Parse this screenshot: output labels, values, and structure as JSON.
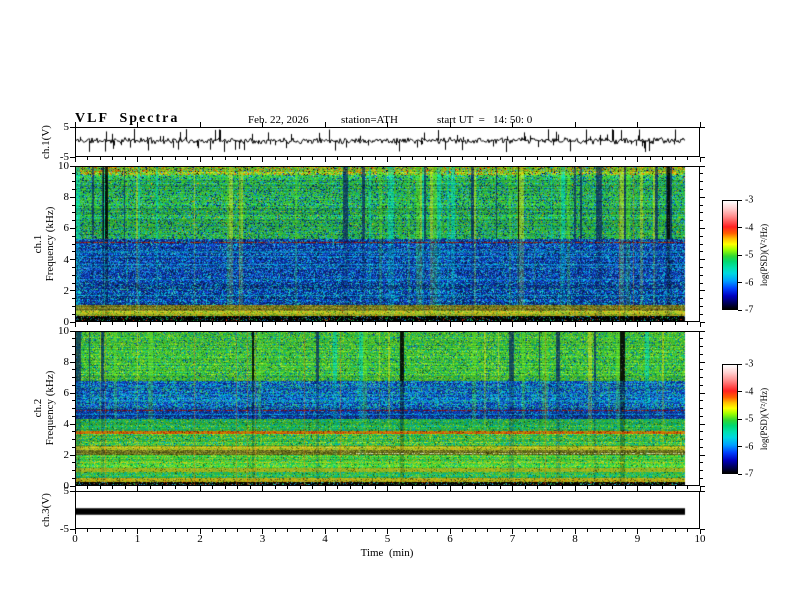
{
  "header": {
    "title": "VLF  Spectra",
    "date": "Feb. 22, 2026",
    "station": "station=ATH",
    "start_ut": "start UT  =   14: 50: 0"
  },
  "axes": {
    "x_label": "Time  (min)",
    "x_tick_labels": [
      "0",
      "1",
      "2",
      "3",
      "4",
      "5",
      "6",
      "7",
      "8",
      "9",
      "10"
    ],
    "freq_tick_labels": [
      "10",
      "8",
      "6",
      "4",
      "2",
      "0"
    ],
    "volt_top_label": "5",
    "volt_bottom_label": "-5"
  },
  "panels": {
    "ch1_wave": {
      "ylabel": "ch.1(V)"
    },
    "ch1_spec": {
      "ylabel_ch": "ch.1",
      "ylabel_freq": "Frequency  (kHz)"
    },
    "ch2_spec": {
      "ylabel_ch": "ch.2",
      "ylabel_freq": "Frequency  (kHz)"
    },
    "ch3_wave": {
      "ylabel": "ch.3(V)"
    }
  },
  "colorbar": {
    "label": "log(PSD)(V²/Hz)",
    "tick_labels": [
      "-3",
      "-4",
      "-5",
      "-6",
      "-7"
    ],
    "gradient": [
      [
        "#ffffff",
        0
      ],
      [
        "#ffd0d0",
        7
      ],
      [
        "#ff9090",
        14
      ],
      [
        "#ff2020",
        24
      ],
      [
        "#ff6000",
        30
      ],
      [
        "#ffc000",
        35
      ],
      [
        "#ffff00",
        40
      ],
      [
        "#a0ff00",
        45
      ],
      [
        "#30d830",
        51
      ],
      [
        "#00d870",
        56
      ],
      [
        "#00e0b0",
        62
      ],
      [
        "#00d8e0",
        67
      ],
      [
        "#00a0ff",
        74
      ],
      [
        "#0040ff",
        81
      ],
      [
        "#0000c0",
        88
      ],
      [
        "#000050",
        95
      ],
      [
        "#000000",
        100
      ]
    ]
  },
  "chart_data": [
    {
      "id": "ch1_voltage",
      "type": "line",
      "x_range_min": [
        0,
        10
      ],
      "x_data_end_min": 9.78,
      "y_range": [
        -5,
        5
      ],
      "y_unit": "V",
      "baseline": 0.5,
      "noise_amp": 1.3,
      "n_spikes": 85,
      "spike_amp": [
        1.2,
        4.2
      ],
      "spike_down_frac": 0.6,
      "seed": 11
    },
    {
      "id": "ch1_spectrogram",
      "type": "heatmap",
      "x_range_min": [
        0,
        10
      ],
      "x_data_end_min": 9.78,
      "y_range_khz": [
        0,
        10
      ],
      "z_label": "log(PSD)(V²/Hz)",
      "z_range": [
        -7,
        -3
      ],
      "seed": 101,
      "row_jitter": 0.3,
      "stripes": {
        "p_black": 0.05,
        "p_dark": 0.07,
        "p_bright": 0.24,
        "max_run": 4,
        "bright_colors": [
          "#58dc20",
          "#00dcb8",
          "#c8e018"
        ]
      },
      "bands": [
        {
          "f0": 9.5,
          "f1": 10,
          "stripe": 0.9,
          "palette": [
            [
              "#50c428",
              3
            ],
            [
              "#88d420",
              2.5
            ],
            [
              "#c8d820",
              1.5
            ],
            [
              "#e89800",
              1.2
            ],
            [
              "#e05000",
              0.7
            ],
            [
              "#28a8d8",
              0.8
            ],
            [
              "#0a2a80",
              0.5
            ],
            [
              "#000000",
              0.3
            ]
          ]
        },
        {
          "f0": 5.3,
          "f1": 9.5,
          "stripe": 1,
          "palette": [
            [
              "#30b438",
              3
            ],
            [
              "#48c828",
              3
            ],
            [
              "#18a058",
              2
            ],
            [
              "#00c090",
              1.2
            ],
            [
              "#28a8d0",
              1
            ],
            [
              "#0a50b8",
              0.8
            ],
            [
              "#082868",
              0.8
            ],
            [
              "#e08800",
              0.15
            ]
          ]
        },
        {
          "f0": 2.45,
          "f1": 5.3,
          "stripe": 0.45,
          "bright_row": 0.12,
          "palette": [
            [
              "#0a2a90",
              3
            ],
            [
              "#1048c8",
              3
            ],
            [
              "#2080d8",
              1.4
            ],
            [
              "#00b0d8",
              1.1
            ],
            [
              "#062050",
              1.3
            ],
            [
              "#30c090",
              0.35
            ]
          ]
        },
        {
          "f0": 1.05,
          "f1": 2.45,
          "stripe": 0.35,
          "bright_row": 0.14,
          "palette": [
            [
              "#0a2a90",
              3
            ],
            [
              "#1048c8",
              2
            ],
            [
              "#00a0c8",
              1.6
            ],
            [
              "#062050",
              1.6
            ],
            [
              "#28b8a0",
              0.6
            ]
          ]
        },
        {
          "f0": 0.62,
          "f1": 1.05,
          "stripe": 0.2,
          "palette": [
            [
              "#7e7e1e",
              3
            ],
            [
              "#9a9a28",
              2
            ],
            [
              "#5e6e1a",
              2
            ],
            [
              "#8a4e10",
              1
            ],
            [
              "#3e5e10",
              1
            ]
          ]
        },
        {
          "f0": 0.35,
          "f1": 0.62,
          "stripe": 0.2,
          "palette": [
            [
              "#bcbc1e",
              3
            ],
            [
              "#8cbc28",
              2
            ],
            [
              "#cc9c10",
              1.2
            ],
            [
              "#5a9c1c",
              1
            ]
          ]
        },
        {
          "f0": 0,
          "f1": 0.35,
          "stripe": 0,
          "palette": [
            [
              "#000000",
              5
            ],
            [
              "#0a3014",
              0.5
            ],
            [
              "#10a040",
              0.5
            ],
            [
              "#0868b0",
              0.4
            ],
            [
              "#b02408",
              0.2
            ]
          ]
        }
      ],
      "hlines": [
        {
          "f": 5.1,
          "colors": [
            "#780020",
            "#a83808"
          ],
          "density": 0.75
        },
        {
          "f": 2.1,
          "colors": [
            "#28b890",
            "#1048c8"
          ],
          "density": 0.6
        },
        {
          "f": 1.75,
          "colors": [
            "#2090c0",
            "#0a2a90"
          ],
          "density": 0.5
        }
      ]
    },
    {
      "id": "ch2_spectrogram",
      "type": "heatmap",
      "x_range_min": [
        0,
        10
      ],
      "x_data_end_min": 9.78,
      "y_range_khz": [
        0,
        10
      ],
      "z_label": "log(PSD)(V²/Hz)",
      "z_range": [
        -7,
        -3
      ],
      "seed": 202,
      "row_jitter": 0.25,
      "stripes": {
        "p_black": 0.085,
        "p_dark": 0.06,
        "p_bright": 0.22,
        "max_run": 5,
        "bright_colors": [
          "#60dc20",
          "#00dcb8",
          "#d4dc14"
        ]
      },
      "bands": [
        {
          "f0": 6.8,
          "f1": 10,
          "stripe": 1,
          "palette": [
            [
              "#38bc30",
              3
            ],
            [
              "#58cc28",
              3
            ],
            [
              "#18a858",
              2
            ],
            [
              "#9cd420",
              1.2
            ],
            [
              "#00bca0",
              0.7
            ],
            [
              "#0a50b8",
              0.5
            ]
          ]
        },
        {
          "f0": 5.0,
          "f1": 6.8,
          "stripe": 0.55,
          "bright_row": 0.12,
          "palette": [
            [
              "#1048c8",
              2.2
            ],
            [
              "#0a2a90",
              2.2
            ],
            [
              "#00b0d8",
              1.8
            ],
            [
              "#2080d8",
              1.4
            ],
            [
              "#30c060",
              1
            ]
          ]
        },
        {
          "f0": 4.3,
          "f1": 5.0,
          "stripe": 0.45,
          "bright_row": 0.1,
          "palette": [
            [
              "#0a2a90",
              3
            ],
            [
              "#083060",
              1.6
            ],
            [
              "#1048c8",
              2.2
            ],
            [
              "#00a0c8",
              0.9
            ]
          ]
        },
        {
          "f0": 3.55,
          "f1": 4.3,
          "stripe": 0.35,
          "palette": [
            [
              "#28b040",
              3
            ],
            [
              "#00bc80",
              2
            ],
            [
              "#48cc28",
              2
            ],
            [
              "#00a8c0",
              1
            ],
            [
              "#94d020",
              0.8
            ]
          ]
        },
        {
          "f0": 3.32,
          "f1": 3.55,
          "stripe": 0.15,
          "palette": [
            [
              "#e87008",
              3
            ],
            [
              "#d89c00",
              2
            ],
            [
              "#bc3408",
              1.5
            ],
            [
              "#94ac1c",
              1
            ]
          ]
        },
        {
          "f0": 2.55,
          "f1": 3.32,
          "stripe": 0.3,
          "palette": [
            [
              "#38bc38",
              3
            ],
            [
              "#78cc28",
              2
            ],
            [
              "#00bc70",
              1.5
            ],
            [
              "#acd01c",
              1.1
            ],
            [
              "#00a0c8",
              0.7
            ]
          ]
        },
        {
          "f0": 2.3,
          "f1": 2.55,
          "stripe": 0.2,
          "palette": [
            [
              "#c4c81c",
              3
            ],
            [
              "#9cbc28",
              2
            ],
            [
              "#d8a810",
              1.2
            ],
            [
              "#68ac1c",
              1
            ]
          ]
        },
        {
          "f0": 1.95,
          "f1": 2.3,
          "stripe": 0.2,
          "palette": [
            [
              "#64681a",
              3
            ],
            [
              "#84842a",
              2
            ],
            [
              "#4a5410",
              2
            ],
            [
              "#98a428",
              1
            ]
          ]
        },
        {
          "f0": 1.1,
          "f1": 1.95,
          "stripe": 0.25,
          "palette": [
            [
              "#40c430",
              3
            ],
            [
              "#68cc28",
              2
            ],
            [
              "#00bc60",
              1.5
            ],
            [
              "#a0cc1c",
              1.2
            ],
            [
              "#28b0a0",
              0.5
            ]
          ]
        },
        {
          "f0": 0.85,
          "f1": 1.1,
          "stripe": 0.2,
          "palette": [
            [
              "#a4c424",
              3
            ],
            [
              "#c4c414",
              2
            ],
            [
              "#78b424",
              1.5
            ]
          ]
        },
        {
          "f0": 0.45,
          "f1": 0.85,
          "stripe": 0.2,
          "palette": [
            [
              "#38bc38",
              3
            ],
            [
              "#00bc80",
              1.5
            ],
            [
              "#78c828",
              1.5
            ],
            [
              "#00a8b8",
              0.8
            ]
          ]
        },
        {
          "f0": 0.18,
          "f1": 0.45,
          "stripe": 0.15,
          "palette": [
            [
              "#ccc414",
              3
            ],
            [
              "#a4b41c",
              2
            ],
            [
              "#d89408",
              1.2
            ],
            [
              "#5a6c18",
              0.7
            ]
          ]
        },
        {
          "f0": 0,
          "f1": 0.18,
          "stripe": 0,
          "palette": [
            [
              "#000000",
              5
            ],
            [
              "#104830",
              0.6
            ],
            [
              "#2090c0",
              0.5
            ],
            [
              "#28a040",
              0.5
            ],
            [
              "#a82408",
              0.3
            ]
          ]
        }
      ],
      "hlines": [
        {
          "f": 4.87,
          "colors": [
            "#700018",
            "#983008"
          ],
          "density": 0.7
        },
        {
          "f": 3.42,
          "colors": [
            "#e03800",
            "#d87800"
          ],
          "density": 0.8
        },
        {
          "f": 2.12,
          "colors": [
            "#d8e8c0",
            "#a8b868"
          ],
          "density": 0.5,
          "x0": 0.45
        },
        {
          "f": 1.52,
          "colors": [
            "#ccd018",
            "#94bc20"
          ],
          "density": 0.6
        }
      ]
    },
    {
      "id": "ch3_voltage",
      "type": "line",
      "x_range_min": [
        0,
        10
      ],
      "x_data_end_min": 9.78,
      "y_range": [
        -5,
        5
      ],
      "y_unit": "V",
      "value": 0,
      "line_thickness_v": 0.9,
      "seed": 3
    }
  ]
}
